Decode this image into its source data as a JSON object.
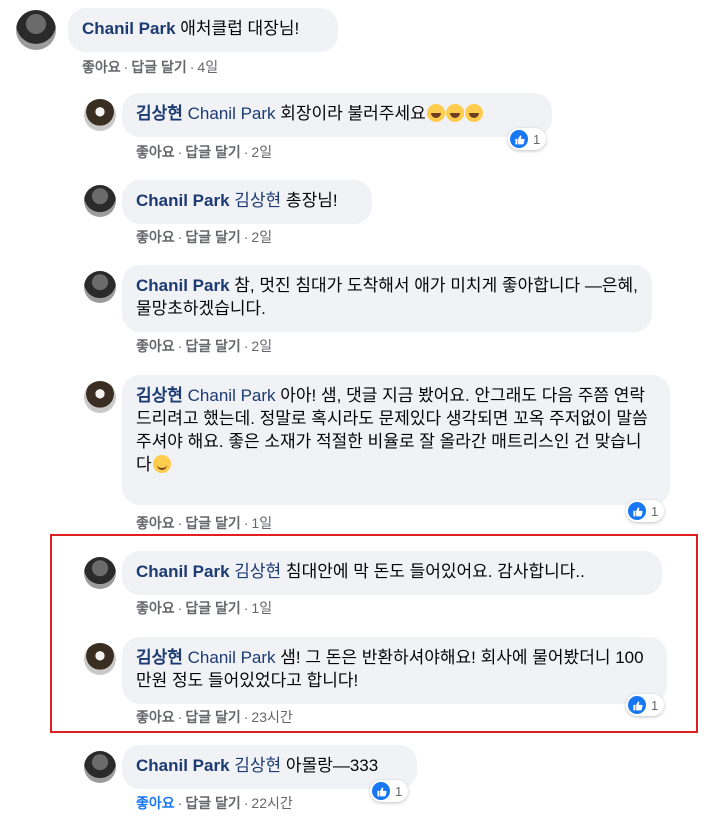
{
  "actions": {
    "like": "좋아요",
    "reply": "답글 달기",
    "sep": "·"
  },
  "comments": [
    {
      "author": "Chanil Park",
      "tag": "",
      "text": " 애처클럽 대장님!",
      "time": "4일",
      "reactions": ""
    },
    {
      "author": "김상현",
      "tag": "Chanil Park",
      "text": " 회장이라 불러주세요",
      "time": "2일",
      "reactions": "1"
    },
    {
      "author": "Chanil Park",
      "tag": "김상현",
      "text": " 총장님!",
      "time": "2일",
      "reactions": ""
    },
    {
      "author": "Chanil Park",
      "tag": "",
      "text": " 참, 멋진 침대가 도착해서 애가 미치게 좋아합니다 —은혜, 물망초하겠습니다.",
      "time": "2일",
      "reactions": ""
    },
    {
      "author": "김상현",
      "tag": "Chanil Park",
      "text": " 아아! 샘, 댓글 지금 봤어요. 안그래도 다음 주쯤 연락드리려고 했는데. 정말로 혹시라도 문제있다 생각되면 꼬옥 주저없이 말씀주셔야 해요. 좋은 소재가 적절한 비율로 잘 올라간 매트리스인 건 맞습니다",
      "time": "1일",
      "reactions": "1"
    },
    {
      "author": "Chanil Park",
      "tag": "김상현",
      "text": " 침대안에 막 돈도 들어있어요. 감사합니다..",
      "time": "1일",
      "reactions": ""
    },
    {
      "author": "김상현",
      "tag": "Chanil Park",
      "text": " 샘! 그 돈은 반환하셔야해요! 회사에 물어봤더니 100만원 정도 들어있었다고 합니다!",
      "time": "23시간",
      "reactions": "1"
    },
    {
      "author": "Chanil Park",
      "tag": "김상현",
      "text": " 아몰랑—333",
      "time": "22시간",
      "reactions": "1"
    }
  ],
  "colors": {
    "author": "#1c3a73",
    "bubble": "#f0f2f5",
    "accent": "#1877f2",
    "highlight": "#e02020"
  }
}
